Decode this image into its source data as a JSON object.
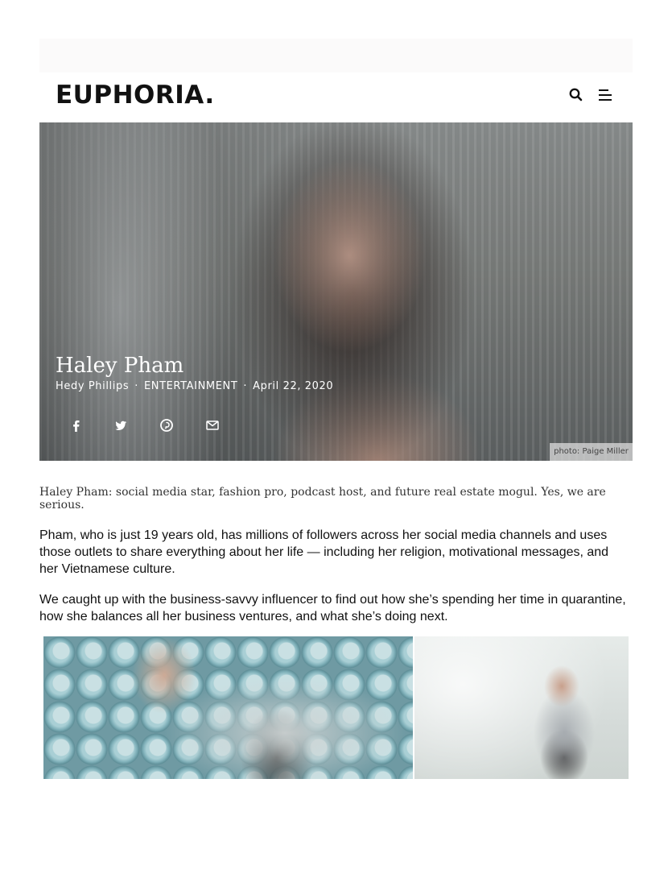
{
  "site": {
    "logo": "EUPHORIA."
  },
  "header": {
    "search_icon": "search-icon",
    "menu_icon": "menu-icon"
  },
  "hero": {
    "title": "Haley Pham",
    "author": "Hedy Phillips",
    "separator": "·",
    "category": "ENTERTAINMENT",
    "date": "April 22, 2020",
    "share_icons": [
      "facebook-icon",
      "twitter-icon",
      "pinterest-icon",
      "email-icon"
    ],
    "photo_credit": "photo: Paige Miller"
  },
  "article": {
    "lede": "Haley Pham: social media star, fashion pro, podcast host, and future real estate mogul. Yes, we are serious.",
    "paragraphs": [
      "Pham, who is just 19 years old, has millions of followers across her social media channels and uses those outlets to share everything about her life — including her religion, motivational messages, and her Vietnamese culture.",
      "We caught up with the business-savvy influencer to find out how she’s spending her time in quarantine, how she balances all her business ventures, and what she’s doing next."
    ]
  },
  "colors": {
    "text": "#111111",
    "lede": "#333333",
    "hero_text": "#ffffff"
  }
}
